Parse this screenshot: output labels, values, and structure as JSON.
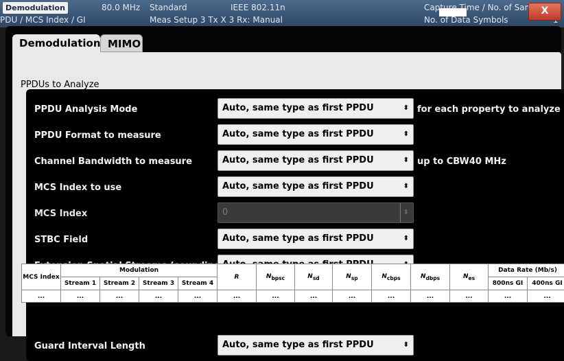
{
  "background": {
    "label": "Demodulation",
    "frequency": "80.0 MHz",
    "standard_label": "Standard",
    "standard_value": "IEEE 802.11n",
    "line2a": "PDU / MCS Index / GI",
    "line2b": "Meas Setup  3 Tx X 3 Rx: Manual",
    "capture": "Capture Time / No. of Samp",
    "symbols": "No. of Data Symbols",
    "right_char": "1",
    "close_label": "X"
  },
  "tabs": [
    {
      "label": "Demodulation",
      "active": true
    },
    {
      "label": "MIMO",
      "active": false
    }
  ],
  "section_title": "PPDUs to Analyze",
  "rows": [
    {
      "label": "PPDU Analysis Mode",
      "value": "Auto, same type as first PPDU",
      "note": "for each property to analyze"
    },
    {
      "label": "PPDU Format to measure",
      "value": "Auto, same type as first PPDU",
      "note": ""
    },
    {
      "label": "Channel Bandwidth to measure",
      "value": "Auto, same type as first PPDU",
      "note": "up to CBW40 MHz"
    },
    {
      "label": "MCS Index to use",
      "value": "Auto, same type as first PPDU",
      "note": ""
    },
    {
      "label": "MCS Index",
      "value": "0",
      "note": "",
      "disabled": true
    },
    {
      "label": "STBC Field",
      "value": "Auto, same type as first PPDU",
      "note": ""
    },
    {
      "label": "Extension Spatial Streams (sounding)",
      "value": "Auto, same type as first PPDU",
      "note": ""
    }
  ],
  "table": {
    "col_mcs": "MCS Index",
    "col_modulation": "Modulation",
    "streams": [
      "Stream 1",
      "Stream 2",
      "Stream 3",
      "Stream 4"
    ],
    "col_r": "R",
    "col_nbpsc": "N",
    "col_nbpsc_sub": "bpsc",
    "col_nsd": "N",
    "col_nsd_sub": "sd",
    "col_nsp": "N",
    "col_nsp_sub": "sp",
    "col_ncbps": "N",
    "col_ncbps_sub": "cbps",
    "col_ndbps": "N",
    "col_ndbps_sub": "dbps",
    "col_nes": "N",
    "col_nes_sub": "es",
    "col_datarate": "Data Rate (Mb/s)",
    "gi800": "800ns GI",
    "gi400": "400ns GI",
    "cell": "..."
  },
  "guard": {
    "label": "Guard Interval Length",
    "value": "Auto, same type as first PPDU"
  },
  "icons": {
    "combo_arrow": "up-down-arrows",
    "close": "close-icon"
  }
}
